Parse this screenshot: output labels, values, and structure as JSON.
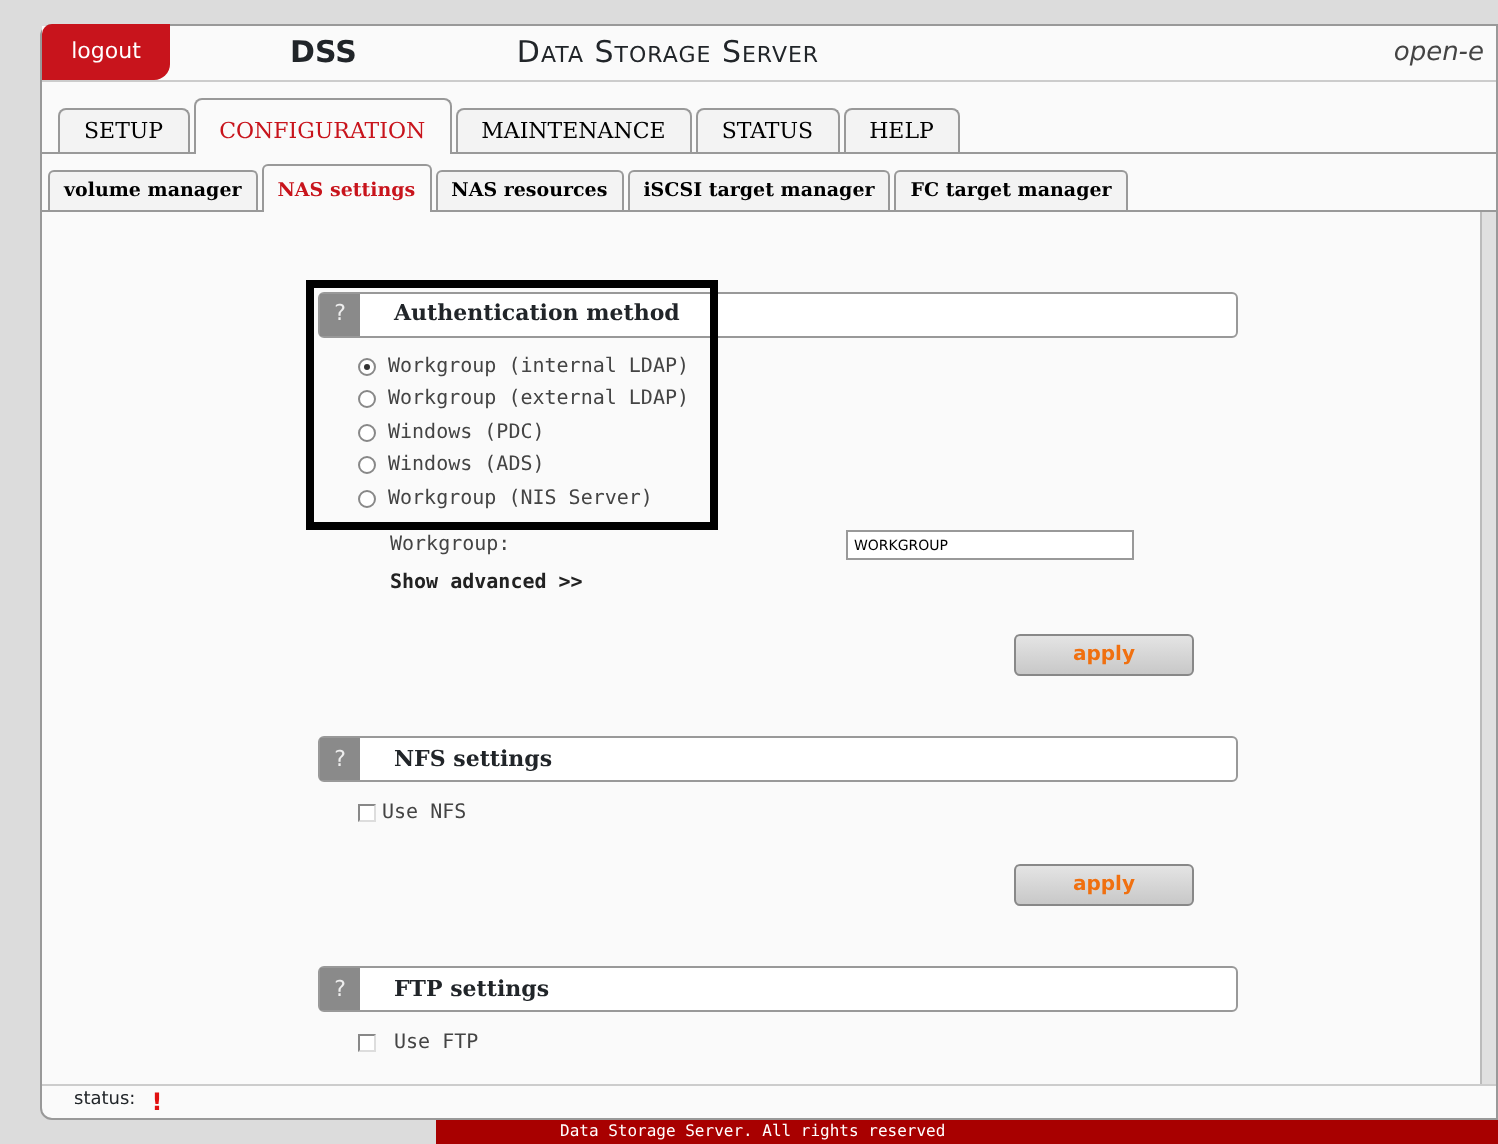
{
  "header": {
    "logout": "logout",
    "product": "DSS",
    "title": "Data Storage Server",
    "brand": "open-e"
  },
  "tabs": [
    {
      "label": "SETUP",
      "selected": false
    },
    {
      "label": "CONFIGURATION",
      "selected": true
    },
    {
      "label": "MAINTENANCE",
      "selected": false
    },
    {
      "label": "STATUS",
      "selected": false
    },
    {
      "label": "HELP",
      "selected": false
    }
  ],
  "subtabs": [
    {
      "label": "volume manager",
      "selected": false
    },
    {
      "label": "NAS settings",
      "selected": true
    },
    {
      "label": "NAS resources",
      "selected": false
    },
    {
      "label": "iSCSI target manager",
      "selected": false
    },
    {
      "label": "FC target manager",
      "selected": false
    }
  ],
  "sections": [
    {
      "help": "?",
      "title": "Authentication method",
      "highlighted": true,
      "options": [
        {
          "label": "Workgroup (internal LDAP)",
          "selected": true
        },
        {
          "label": "Workgroup (external LDAP)",
          "selected": false
        },
        {
          "label": "Windows (PDC)",
          "selected": false
        },
        {
          "label": "Windows (ADS)",
          "selected": false
        },
        {
          "label": "Workgroup (NIS Server)",
          "selected": false
        }
      ],
      "field": {
        "label": "Workgroup:",
        "value": "WORKGROUP"
      },
      "link": "Show advanced >>",
      "button": "apply"
    },
    {
      "help": "?",
      "title": "NFS settings",
      "highlighted": false,
      "checkbox": {
        "label": "Use NFS",
        "checked": false
      },
      "button": "apply"
    },
    {
      "help": "?",
      "title": "FTP settings",
      "highlighted": false,
      "checkbox": {
        "label": "Use FTP",
        "checked": false
      }
    }
  ],
  "status_bar": {
    "label": "status:",
    "icon": "!"
  },
  "footer": "Data Storage Server. All rights reserved"
}
